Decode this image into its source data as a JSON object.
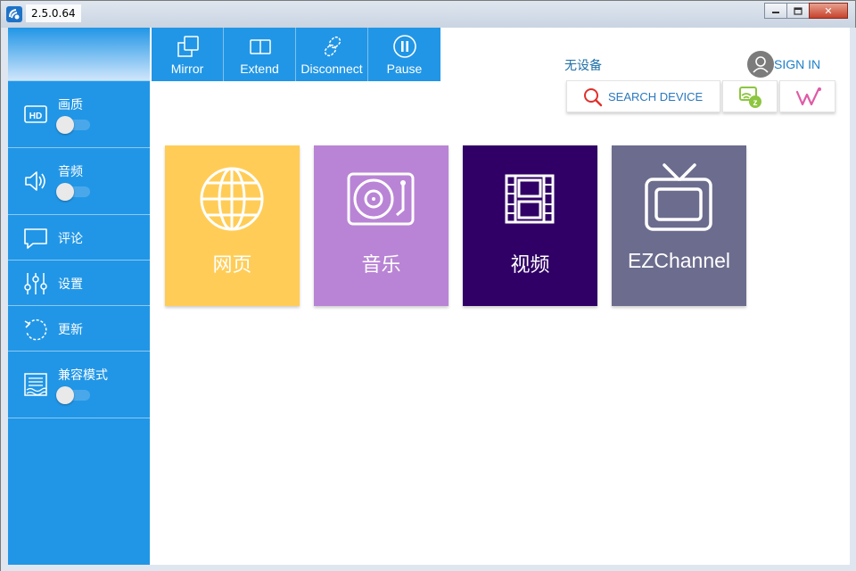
{
  "window": {
    "version": "2.5.0.64",
    "minimize_symbol": "▭",
    "maximize_symbol": "□",
    "close_symbol": "✕"
  },
  "sidebar": {
    "items": [
      {
        "label": "画质",
        "icon": "hd-icon",
        "toggle": false
      },
      {
        "label": "音频",
        "icon": "speaker-icon",
        "toggle": false
      },
      {
        "label": "评论",
        "icon": "comment-icon"
      },
      {
        "label": "设置",
        "icon": "sliders-icon"
      },
      {
        "label": "更新",
        "icon": "refresh-icon"
      },
      {
        "label": "兼容模式",
        "icon": "compat-icon",
        "toggle": false
      }
    ]
  },
  "toolbar": {
    "buttons": [
      {
        "label": "Mirror",
        "icon": "mirror-icon"
      },
      {
        "label": "Extend",
        "icon": "extend-icon"
      },
      {
        "label": "Disconnect",
        "icon": "disconnect-icon"
      },
      {
        "label": "Pause",
        "icon": "pause-icon"
      }
    ]
  },
  "header": {
    "device_status": "无设备",
    "sign_in": "SIGN IN",
    "search_device": "SEARCH DEVICE"
  },
  "tiles": [
    {
      "label": "网页",
      "color": "#ffcd57",
      "icon": "globe-icon"
    },
    {
      "label": "音乐",
      "color": "#b984d5",
      "icon": "turntable-icon"
    },
    {
      "label": "视频",
      "color": "#300066",
      "icon": "film-icon"
    },
    {
      "label": "EZChannel",
      "color": "#6c6c8e",
      "icon": "tv-icon"
    }
  ],
  "colors": {
    "accent": "#2196e6",
    "search_icon": "#e0302b",
    "ez_icon": "#8cc63f",
    "w_icon": "#e05aa6"
  }
}
